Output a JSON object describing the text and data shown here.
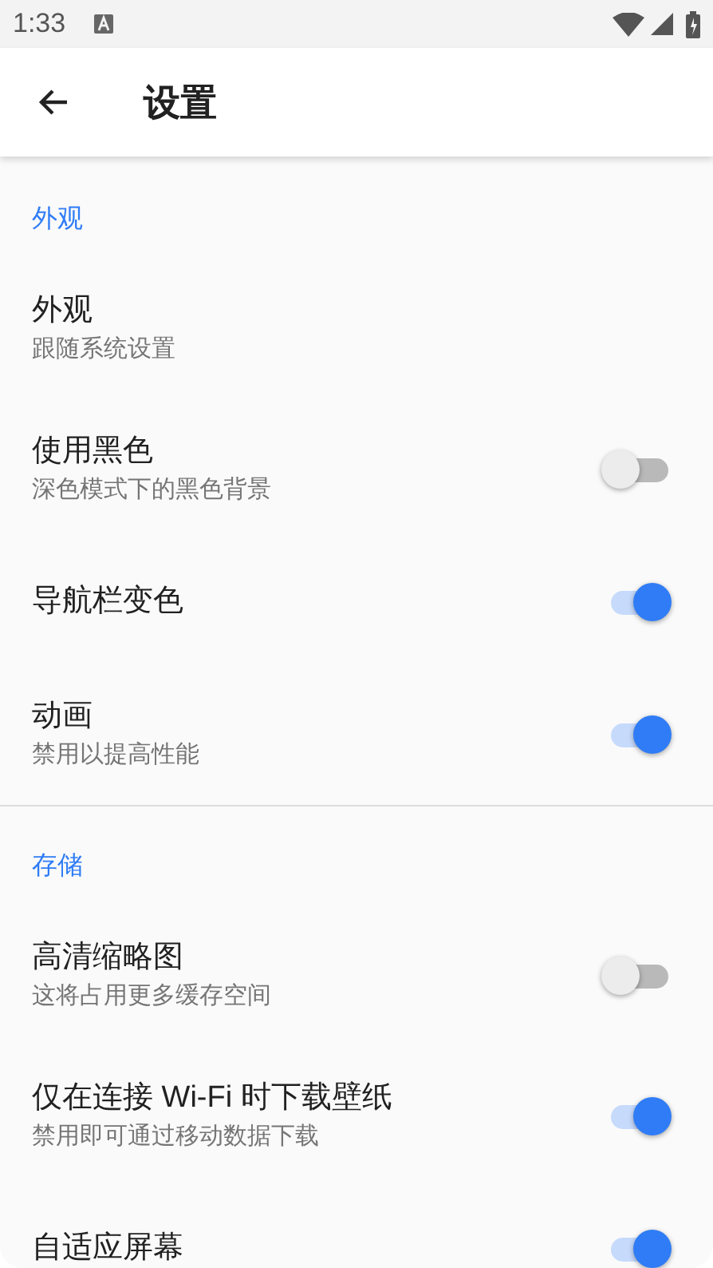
{
  "status_bar": {
    "time": "1:33"
  },
  "app_bar": {
    "title": "设置"
  },
  "sections": [
    {
      "header": "外观",
      "items": [
        {
          "kind": "plain",
          "title": "外观",
          "subtitle": "跟随系统设置"
        },
        {
          "kind": "switch",
          "title": "使用黑色",
          "subtitle": "深色模式下的黑色背景",
          "on": false
        },
        {
          "kind": "switch",
          "title": "导航栏变色",
          "on": true
        },
        {
          "kind": "switch",
          "title": "动画",
          "subtitle": "禁用以提高性能",
          "on": true
        }
      ]
    },
    {
      "header": "存储",
      "items": [
        {
          "kind": "switch",
          "title": "高清缩略图",
          "subtitle": "这将占用更多缓存空间",
          "on": false
        },
        {
          "kind": "switch",
          "title": "仅在连接 Wi-Fi 时下载壁纸",
          "subtitle": "禁用即可通过移动数据下载",
          "on": true
        },
        {
          "kind": "switch",
          "title": "自适应屏幕",
          "on": true
        }
      ]
    }
  ]
}
